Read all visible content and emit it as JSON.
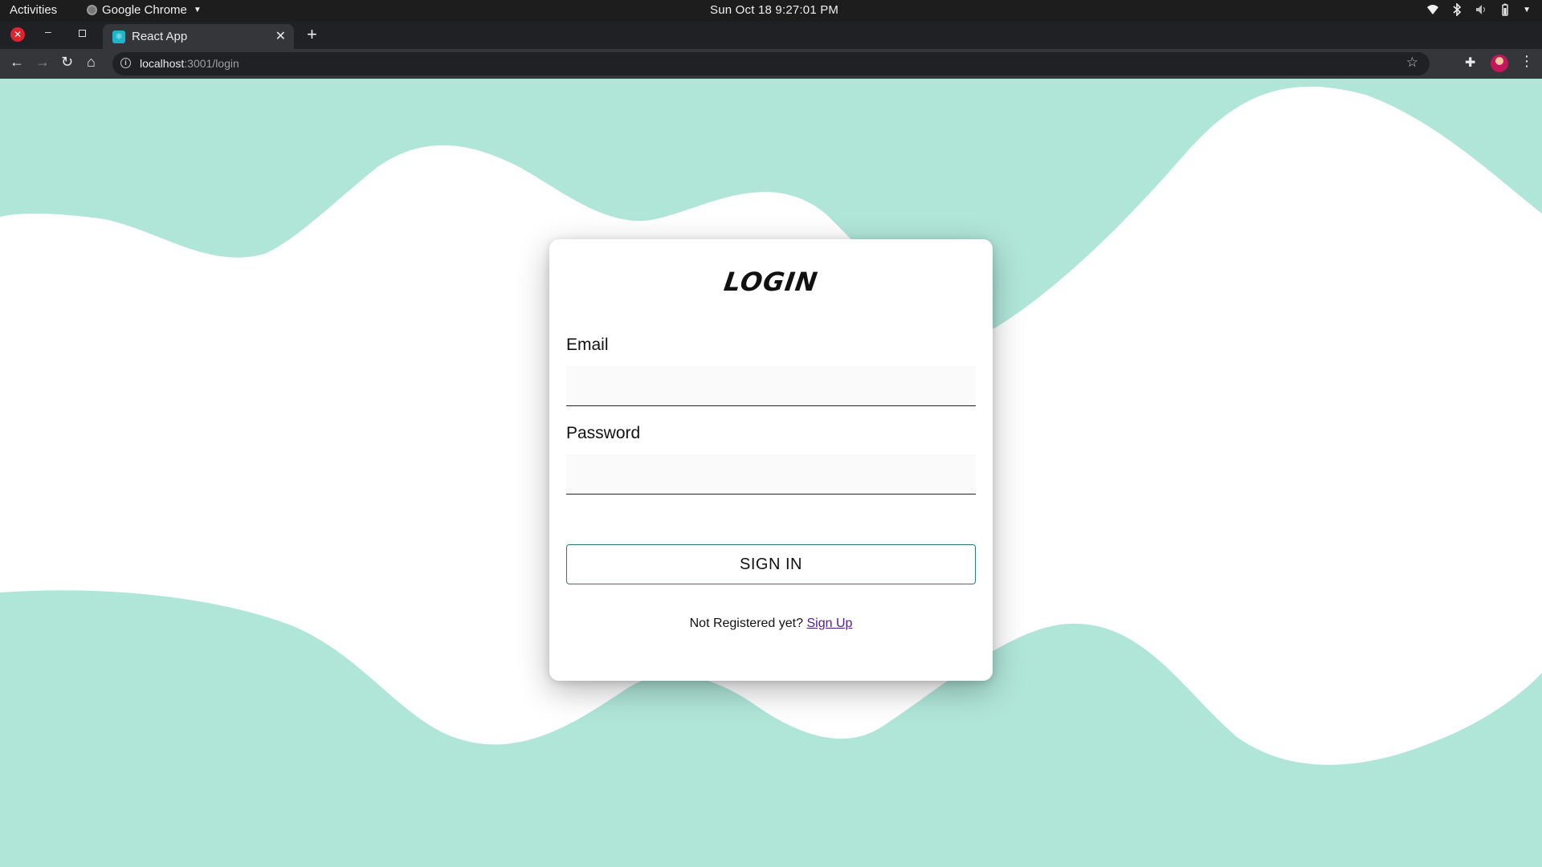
{
  "system_bar": {
    "activities": "Activities",
    "app_name": "Google Chrome",
    "clock": "Sun Oct 18  9:27:01 PM"
  },
  "browser": {
    "tab_title": "React App",
    "url_host": "localhost",
    "url_path": ":3001/login"
  },
  "login": {
    "title": "LOGIN",
    "email_label": "Email",
    "email_value": "",
    "password_label": "Password",
    "password_value": "",
    "submit_label": "SIGN IN",
    "footer_prompt": "Not Registered yet?",
    "signup_link": "Sign Up"
  },
  "colors": {
    "wave": "#b0e6d8",
    "button_border": "#2b7a78",
    "link": "#551a8b"
  }
}
